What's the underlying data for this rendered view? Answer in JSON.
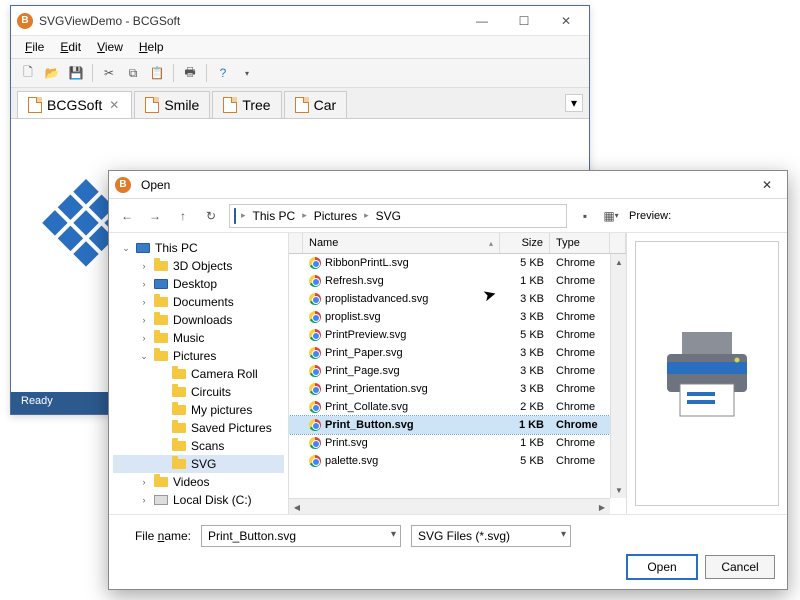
{
  "app": {
    "title": "SVGViewDemo - BCGSoft",
    "menus": [
      "File",
      "Edit",
      "View",
      "Help"
    ],
    "status": "Ready"
  },
  "tabs": [
    {
      "label": "BCGSoft",
      "active": true,
      "closable": true
    },
    {
      "label": "Smile",
      "active": false,
      "closable": false
    },
    {
      "label": "Tree",
      "active": false,
      "closable": false
    },
    {
      "label": "Car",
      "active": false,
      "closable": false
    }
  ],
  "dialog": {
    "title": "Open",
    "breadcrumb": [
      "This PC",
      "Pictures",
      "SVG"
    ],
    "preview_label": "Preview:",
    "tree": [
      {
        "label": "This PC",
        "depth": 0,
        "icon": "pc",
        "expand": "open"
      },
      {
        "label": "3D Objects",
        "depth": 1,
        "icon": "folder",
        "expand": "closed"
      },
      {
        "label": "Desktop",
        "depth": 1,
        "icon": "pc",
        "expand": "closed"
      },
      {
        "label": "Documents",
        "depth": 1,
        "icon": "folder",
        "expand": "closed"
      },
      {
        "label": "Downloads",
        "depth": 1,
        "icon": "folder",
        "expand": "closed"
      },
      {
        "label": "Music",
        "depth": 1,
        "icon": "folder",
        "expand": "closed"
      },
      {
        "label": "Pictures",
        "depth": 1,
        "icon": "folder",
        "expand": "open"
      },
      {
        "label": "Camera Roll",
        "depth": 2,
        "icon": "folder",
        "expand": "none"
      },
      {
        "label": "Circuits",
        "depth": 2,
        "icon": "folder",
        "expand": "none"
      },
      {
        "label": "My pictures",
        "depth": 2,
        "icon": "folder",
        "expand": "none"
      },
      {
        "label": "Saved Pictures",
        "depth": 2,
        "icon": "folder",
        "expand": "none"
      },
      {
        "label": "Scans",
        "depth": 2,
        "icon": "folder",
        "expand": "none"
      },
      {
        "label": "SVG",
        "depth": 2,
        "icon": "folder",
        "expand": "none",
        "selected": true
      },
      {
        "label": "Videos",
        "depth": 1,
        "icon": "folder",
        "expand": "closed"
      },
      {
        "label": "Local Disk (C:)",
        "depth": 1,
        "icon": "drive",
        "expand": "closed"
      }
    ],
    "columns": {
      "name": "Name",
      "size": "Size",
      "type": "Type"
    },
    "files": [
      {
        "name": "palette.svg",
        "size": "5 KB",
        "type": "Chrome"
      },
      {
        "name": "Print.svg",
        "size": "1 KB",
        "type": "Chrome"
      },
      {
        "name": "Print_Button.svg",
        "size": "1 KB",
        "type": "Chrome",
        "selected": true
      },
      {
        "name": "Print_Collate.svg",
        "size": "2 KB",
        "type": "Chrome"
      },
      {
        "name": "Print_Orientation.svg",
        "size": "3 KB",
        "type": "Chrome"
      },
      {
        "name": "Print_Page.svg",
        "size": "3 KB",
        "type": "Chrome"
      },
      {
        "name": "Print_Paper.svg",
        "size": "3 KB",
        "type": "Chrome"
      },
      {
        "name": "PrintPreview.svg",
        "size": "5 KB",
        "type": "Chrome"
      },
      {
        "name": "proplist.svg",
        "size": "3 KB",
        "type": "Chrome"
      },
      {
        "name": "proplistadvanced.svg",
        "size": "3 KB",
        "type": "Chrome"
      },
      {
        "name": "Refresh.svg",
        "size": "1 KB",
        "type": "Chrome"
      },
      {
        "name": "RibbonPrintL.svg",
        "size": "5 KB",
        "type": "Chrome"
      }
    ],
    "filename_label": "File name:",
    "filename_value": "Print_Button.svg",
    "filter_value": "SVG Files (*.svg)",
    "open_btn": "Open",
    "cancel_btn": "Cancel"
  }
}
